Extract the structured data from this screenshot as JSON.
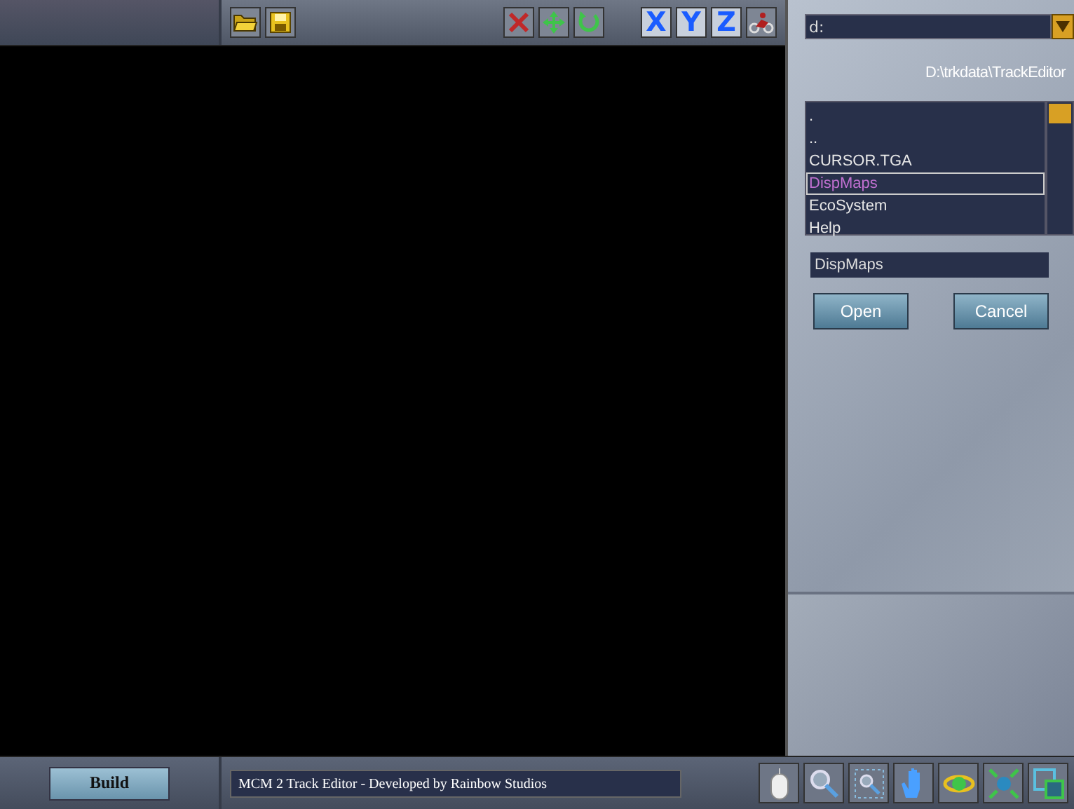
{
  "toolbar": {
    "axis_buttons": [
      "X",
      "Y",
      "Z"
    ]
  },
  "file_browser": {
    "drive": "d:",
    "path": "D:\\trkdata\\TrackEditor",
    "files": [
      {
        "name": ".",
        "selected": false
      },
      {
        "name": "..",
        "selected": false
      },
      {
        "name": "CURSOR.TGA",
        "selected": false
      },
      {
        "name": "DispMaps",
        "selected": true
      },
      {
        "name": "EcoSystem",
        "selected": false
      },
      {
        "name": "Help",
        "selected": false
      }
    ],
    "filename": "DispMaps",
    "buttons": [
      "Open",
      "Cancel"
    ]
  },
  "status_bar": {
    "build_button": "Build",
    "message": "MCM 2 Track Editor - Developed by Rainbow Studios"
  }
}
